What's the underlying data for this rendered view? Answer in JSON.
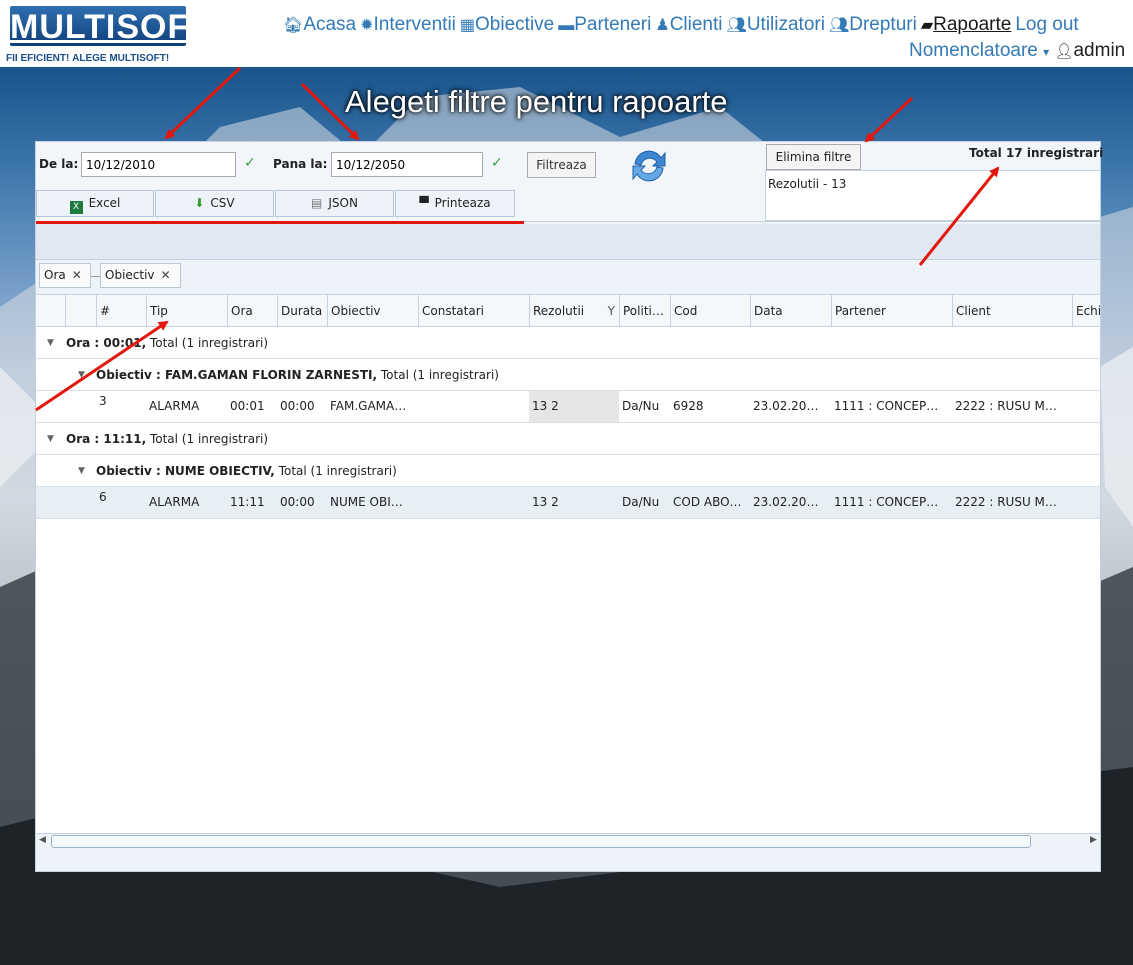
{
  "header": {
    "logo_text": "MULTISOFT",
    "logo_tagline_a": "FII EFICIENT!",
    "logo_tagline_b": "ALEGE MULTISOFT!",
    "nav": [
      {
        "label": "Acasa",
        "icon": "home-icon"
      },
      {
        "label": "Interventii",
        "icon": "gear-icon"
      },
      {
        "label": "Obiective",
        "icon": "building-icon"
      },
      {
        "label": "Parteneri",
        "icon": "briefcase-icon"
      },
      {
        "label": "Clienti",
        "icon": "person-icon"
      },
      {
        "label": "Utilizatori",
        "icon": "users-icon"
      },
      {
        "label": "Drepturi",
        "icon": "users-icon"
      },
      {
        "label": "Rapoarte",
        "icon": "book-icon"
      },
      {
        "label": "Log out",
        "icon": ""
      }
    ],
    "nomenclatoare": "Nomenclatoare",
    "user": "admin"
  },
  "page_title": "Alegeti filtre pentru rapoarte",
  "filters": {
    "from_label": "De la:",
    "from_value": "10/12/2010",
    "to_label": "Pana la:",
    "to_value": "10/12/2050",
    "filter_button": "Filtreaza",
    "remove_filters_button": "Elimina filtre",
    "total_text": "Total 17 inregistrari",
    "active_filter": "Rezolutii - 13",
    "check_mark": "✓"
  },
  "exports": [
    {
      "label": "Excel",
      "icon": "excel-icon"
    },
    {
      "label": "CSV",
      "icon": "csv-icon"
    },
    {
      "label": "JSON",
      "icon": "json-icon"
    },
    {
      "label": "Printeaza",
      "icon": "printer-icon"
    }
  ],
  "group_chips": [
    "Ora",
    "Obiectiv"
  ],
  "columns": [
    "#",
    "Tip",
    "Ora",
    "Durata",
    "Obiectiv",
    "Constatari",
    "Rezolutii",
    "Politi…",
    "Cod",
    "Data",
    "Partener",
    "Client",
    "Echi"
  ],
  "groups": [
    {
      "ora_label": "Ora : 00:01,",
      "ora_total": "Total (1 inregistrari)",
      "obj_label": "Obiectiv : FAM.GAMAN FLORIN ZARNESTI,",
      "obj_total": "Total (1 inregistrari)",
      "row": {
        "nr": "3",
        "tip": "ALARMA",
        "ora": "00:01",
        "durata": "00:00",
        "obiectiv": "FAM.GAMA…",
        "constatari": "",
        "rezolutii": "13 2",
        "politi": "Da/Nu",
        "cod": "6928",
        "data": "23.02.20…",
        "partener": "1111 : CONCEP…",
        "client": "2222 : RUSU M…"
      }
    },
    {
      "ora_label": "Ora : 11:11,",
      "ora_total": "Total (1 inregistrari)",
      "obj_label": "Obiectiv : NUME OBIECTIV,",
      "obj_total": "Total (1 inregistrari)",
      "row": {
        "nr": "6",
        "tip": "ALARMA",
        "ora": "11:11",
        "durata": "00:00",
        "obiectiv": "NUME OBI…",
        "constatari": "",
        "rezolutii": "13 2",
        "politi": "Da/Nu",
        "cod": "COD ABO…",
        "data": "23.02.20…",
        "partener": "1111 : CONCEP…",
        "client": "2222 : RUSU M…"
      }
    }
  ],
  "colors": {
    "accent": "#337ab7",
    "annotation": "#e3170a"
  }
}
